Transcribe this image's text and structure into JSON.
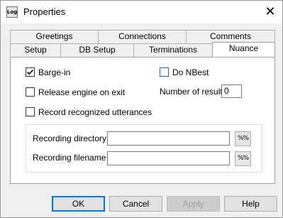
{
  "window": {
    "title": "Properties",
    "icon_text": "Log",
    "close_glyph": "✕"
  },
  "tabs": {
    "row_back": [
      {
        "label": "Greetings"
      },
      {
        "label": "Connections"
      },
      {
        "label": "Comments"
      }
    ],
    "row_front": [
      {
        "label": "Setup"
      },
      {
        "label": "DB Setup"
      },
      {
        "label": "Terminations"
      },
      {
        "label": "Nuance",
        "selected": true
      }
    ]
  },
  "nuance": {
    "barge_in": {
      "label": "Barge-in",
      "checked": true
    },
    "release_engine": {
      "label": "Release engine on exit",
      "checked": false
    },
    "record_utterances": {
      "label": "Record recognized utterances",
      "checked": false
    },
    "do_nbest": {
      "label": "Do NBest",
      "checked": false
    },
    "number_of_results": {
      "label": "Number of results",
      "value": "0"
    },
    "recording_directory": {
      "label": "Recording directory",
      "value": "",
      "browse_glyph": "%%"
    },
    "recording_filename": {
      "label": "Recording filename",
      "value": "",
      "browse_glyph": "%%"
    }
  },
  "buttons": {
    "ok": "OK",
    "cancel": "Cancel",
    "apply": "Apply",
    "help": "Help"
  }
}
